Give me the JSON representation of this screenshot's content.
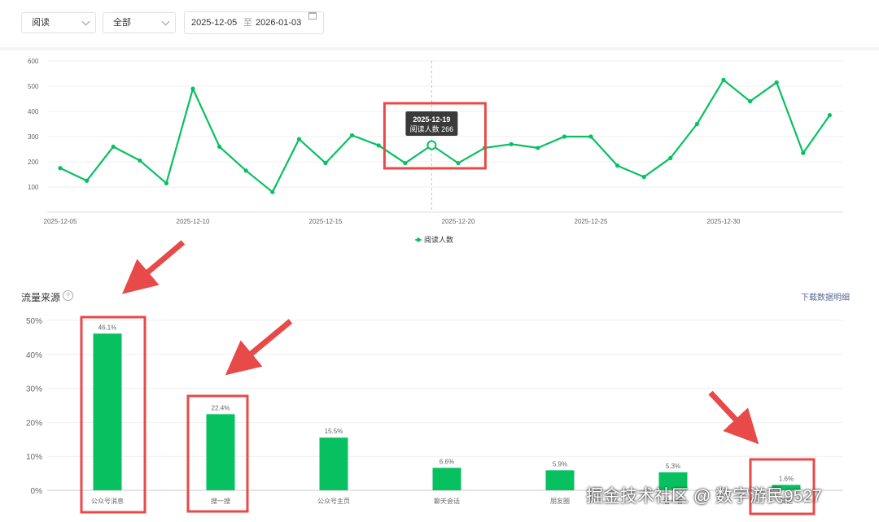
{
  "filters": {
    "metric_select": "阅读",
    "scope_select": "全部",
    "date_start": "2025-12-05",
    "date_sep": "至",
    "date_end": "2026-01-03"
  },
  "section": {
    "title": "流量来源",
    "help_icon": "help-circle-icon",
    "download_label": "下载数据明细"
  },
  "watermark": "掘金技术社区 @ 数字游民9527",
  "colors": {
    "accent": "#07c160",
    "annotation": "#e84a4a",
    "link": "#576b95"
  },
  "chart_data": [
    {
      "type": "line",
      "series": [
        {
          "name": "阅读人数",
          "x": [
            "2025-12-05",
            "2025-12-06",
            "2025-12-07",
            "2025-12-08",
            "2025-12-09",
            "2025-12-10",
            "2025-12-11",
            "2025-12-12",
            "2025-12-13",
            "2025-12-14",
            "2025-12-15",
            "2025-12-16",
            "2025-12-17",
            "2025-12-18",
            "2025-12-19",
            "2025-12-20",
            "2025-12-21",
            "2025-12-22",
            "2025-12-23",
            "2025-12-24",
            "2025-12-25",
            "2025-12-26",
            "2025-12-27",
            "2025-12-28",
            "2025-12-29",
            "2025-12-30",
            "2025-12-31",
            "2026-01-01",
            "2026-01-02",
            "2026-01-03"
          ],
          "values": [
            175,
            125,
            260,
            205,
            115,
            490,
            260,
            165,
            80,
            290,
            195,
            305,
            265,
            195,
            266,
            195,
            255,
            270,
            255,
            300,
            300,
            185,
            140,
            215,
            350,
            525,
            440,
            515,
            235,
            385
          ]
        }
      ],
      "x_ticks": [
        "2025-12-05",
        "2025-12-10",
        "2025-12-15",
        "2025-12-20",
        "2025-12-25",
        "2025-12-30"
      ],
      "y_ticks": [
        "100",
        "200",
        "300",
        "400",
        "500",
        "600"
      ],
      "ylim": [
        0,
        600
      ],
      "grid": true,
      "legend": "bottom-center",
      "tooltip": {
        "title": "2025-12-19",
        "label": "阅读人数 266",
        "x": "2025-12-19"
      }
    },
    {
      "type": "bar",
      "categories": [
        "公众号消息",
        "搜一搜",
        "公众号主页",
        "聊天会话",
        "朋友圈",
        "看一看",
        "其他"
      ],
      "values": [
        46.1,
        22.4,
        15.5,
        6.6,
        5.9,
        5.3,
        1.6
      ],
      "value_labels": [
        "46.1%",
        "22.4%",
        "15.5%",
        "6.6%",
        "5.9%",
        "5.3%",
        "1.6%"
      ],
      "y_ticks": [
        "0%",
        "10%",
        "20%",
        "30%",
        "40%",
        "50%"
      ],
      "ylim": [
        0,
        50
      ],
      "grid": true
    }
  ]
}
